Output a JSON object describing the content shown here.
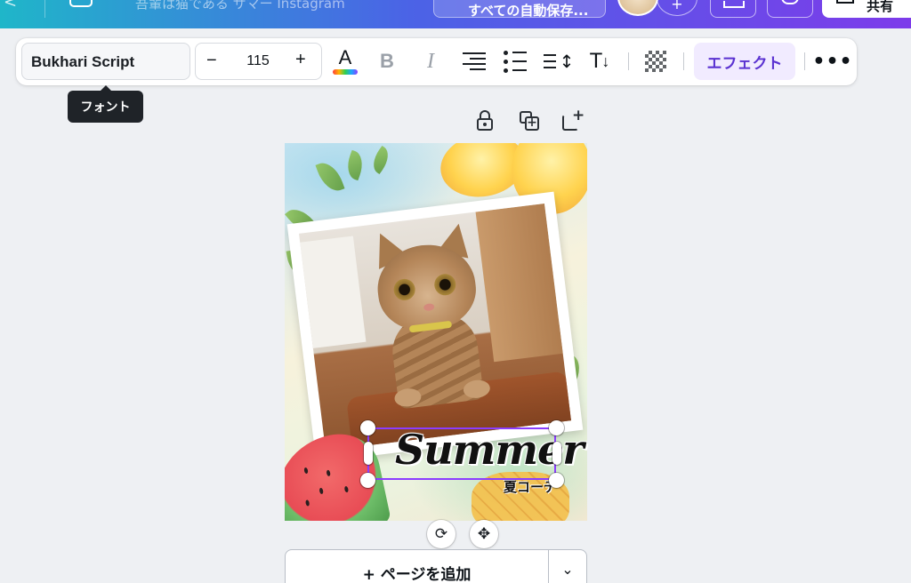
{
  "header": {
    "doc_title": "吾輩は猫である サマー Instagram",
    "share_label": "すべての自動保存...",
    "print_label": "共有"
  },
  "toolbar": {
    "font_name": "Bukhari Script",
    "font_size": "115",
    "decrease_label": "−",
    "increase_label": "+",
    "color_letter": "A",
    "bold_label": "B",
    "italic_label": "I",
    "effects_label": "エフェクト",
    "more_label": "•••"
  },
  "tooltip": {
    "text": "フォント"
  },
  "design": {
    "headline": "Summer",
    "subheadline": "夏コーデ"
  },
  "add_page": {
    "label": "+ ページを追加",
    "caret": "⌄"
  },
  "colors": {
    "accent": "#8b3dff",
    "effects_bg": "#f1ebff",
    "effects_text": "#5a32d1"
  }
}
